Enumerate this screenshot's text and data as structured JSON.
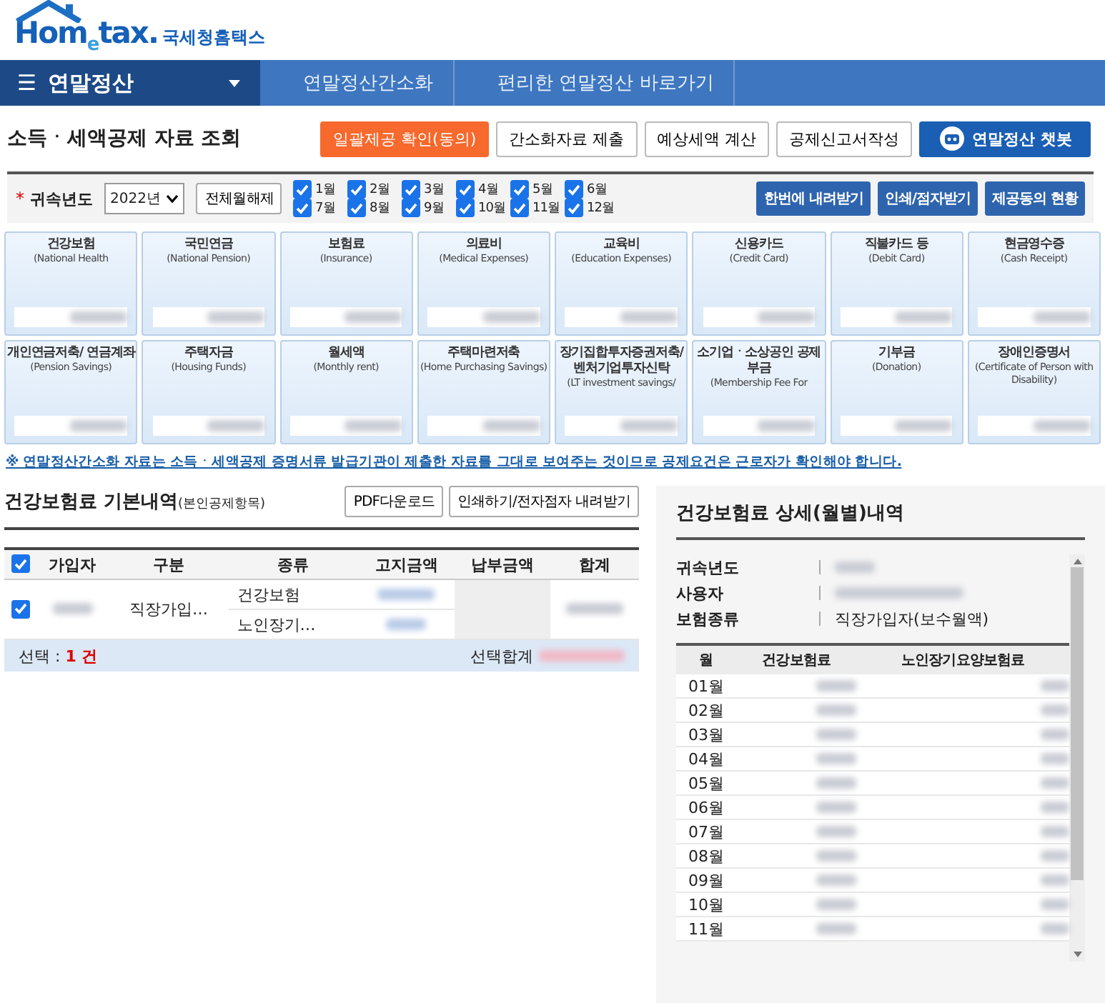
{
  "logo": {
    "word": "Hom$_{e}$tax.",
    "name": "국세청홈택스"
  },
  "nav": {
    "menu_icon": "☰",
    "current": "연말정산",
    "crumbs": [
      "연말정산간소화",
      "편리한 연말정산 바로가기"
    ]
  },
  "page_title": "소득ㆍ세액공제 자료 조회",
  "top_buttons": [
    {
      "label": "일괄제공 확인(동의)",
      "kind": "accent"
    },
    {
      "label": "간소화자료 제출",
      "kind": "plain"
    },
    {
      "label": "예상세액 계산",
      "kind": "plain"
    },
    {
      "label": "공제신고서작성",
      "kind": "plain"
    },
    {
      "label": "연말정산 챗봇",
      "kind": "bot"
    }
  ],
  "filter": {
    "required_mark": "*",
    "label": "귀속년도",
    "year": "2022년",
    "toggle_button": "전체월해제",
    "months": [
      {
        "label": "1월",
        "checked": true
      },
      {
        "label": "2월",
        "checked": true
      },
      {
        "label": "3월",
        "checked": true
      },
      {
        "label": "4월",
        "checked": true
      },
      {
        "label": "5월",
        "checked": true
      },
      {
        "label": "6월",
        "checked": true
      },
      {
        "label": "7월",
        "checked": true
      },
      {
        "label": "8월",
        "checked": true
      },
      {
        "label": "9월",
        "checked": true
      },
      {
        "label": "10월",
        "checked": true
      },
      {
        "label": "11월",
        "checked": true
      },
      {
        "label": "12월",
        "checked": true
      }
    ],
    "buttons": [
      "한번에 내려받기",
      "인쇄/점자받기",
      "제공동의 현황"
    ]
  },
  "categories": [
    {
      "name": "건강보험",
      "english": "(National Health"
    },
    {
      "name": "국민연금",
      "english": "(National Pension)"
    },
    {
      "name": "보험료",
      "english": "(Insurance)"
    },
    {
      "name": "의료비",
      "english": "(Medical Expenses)"
    },
    {
      "name": "교육비",
      "english": "(Education Expenses)"
    },
    {
      "name": "신용카드",
      "english": "(Credit Card)"
    },
    {
      "name": "직불카드 등",
      "english": "(Debit Card)"
    },
    {
      "name": "현금영수증",
      "english": "(Cash Receipt)"
    },
    {
      "name": "개인연금저축/ 연금계좌",
      "english": "(Pension Savings)"
    },
    {
      "name": "주택자금",
      "english": "(Housing Funds)"
    },
    {
      "name": "월세액",
      "english": "(Monthly rent)"
    },
    {
      "name": "주택마련저축",
      "english": "(Home Purchasing Savings)"
    },
    {
      "name": "장기집합투자증권저축/ 벤처기업투자신탁",
      "english": "(LT investment savings/"
    },
    {
      "name": "소기업ㆍ소상공인 공제부금",
      "english": "(Membership Fee For"
    },
    {
      "name": "기부금",
      "english": "(Donation)"
    },
    {
      "name": "장애인증명서",
      "english": "(Certificate of Person with Disability)"
    }
  ],
  "notice": "※ 연말정산간소화 자료는 소득ㆍ세액공제 증명서류 발급기관이 제출한 자료를 그대로 보여주는 것이므로 공제요건은 근로자가 확인해야 합니다.",
  "basic": {
    "title": "건강보험료 기본내역",
    "subtitle": "(본인공제항목)",
    "buttons": [
      "PDF다운로드",
      "인쇄하기/전자점자 내려받기"
    ],
    "select_all": true,
    "columns": [
      "가입자",
      "구분",
      "종류",
      "고지금액",
      "납부금액",
      "합계"
    ],
    "rows": [
      {
        "checked": true,
        "category": "직장가입…",
        "kinds": [
          "건강보험",
          "노인장기…"
        ]
      }
    ],
    "footer": {
      "label": "선택 : ",
      "count": "1 건",
      "total_label": "선택합계"
    }
  },
  "detail": {
    "title": "건강보험료 상세(월별)내역",
    "fields": [
      {
        "label": "귀속년도"
      },
      {
        "label": "사용자"
      },
      {
        "label": "보험종류",
        "value": "직장가입자(보수월액)"
      }
    ],
    "columns": [
      "월",
      "건강보험료",
      "노인장기요양보험료"
    ],
    "months": [
      "01월",
      "02월",
      "03월",
      "04월",
      "05월",
      "06월",
      "07월",
      "08월",
      "09월",
      "10월",
      "11월"
    ]
  }
}
